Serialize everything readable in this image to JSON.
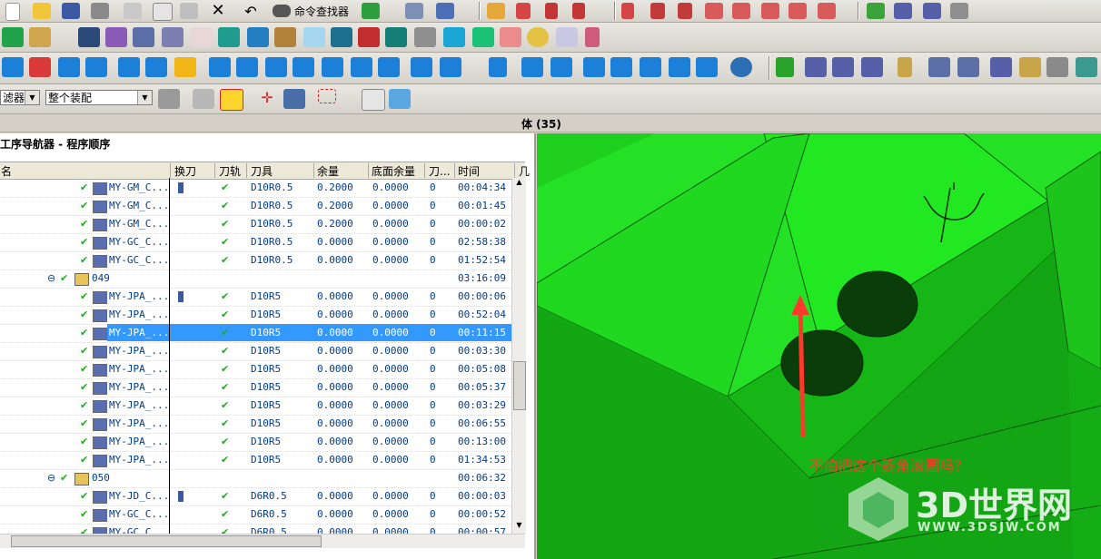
{
  "toolbar": {
    "command_finder_label": "命令查找器",
    "filter_label": "滤器",
    "assembly_selector": "整个装配"
  },
  "viewport": {
    "title": "体 (35)",
    "annotation": "不怕把这个菱角滚圆吗？",
    "watermark_brand": "3D世界网",
    "watermark_url": "WWW.3DSJW.COM",
    "colors": {
      "solid": "#22e022",
      "arrow": "#ff3a2a"
    }
  },
  "navigator": {
    "title": "工序导航器 - 程序顺序",
    "columns": [
      "名",
      "换刀",
      "刀轨",
      "刀具",
      "余量",
      "底面余量",
      "刀...",
      "时间",
      "几"
    ],
    "rows": [
      {
        "name": "MY-GM_C...",
        "tool_change": true,
        "path_ok": true,
        "tool": "D10R0.5",
        "stock": "0.2000",
        "floor": "0.0000",
        "tn": "0",
        "time": "00:04:34"
      },
      {
        "name": "MY-GM_C...",
        "tool_change": false,
        "path_ok": true,
        "tool": "D10R0.5",
        "stock": "0.2000",
        "floor": "0.0000",
        "tn": "0",
        "time": "00:01:45"
      },
      {
        "name": "MY-GM_C...",
        "tool_change": false,
        "path_ok": true,
        "tool": "D10R0.5",
        "stock": "0.2000",
        "floor": "0.0000",
        "tn": "0",
        "time": "00:00:02"
      },
      {
        "name": "MY-GC_C...",
        "tool_change": false,
        "path_ok": true,
        "tool": "D10R0.5",
        "stock": "0.0000",
        "floor": "0.0000",
        "tn": "0",
        "time": "02:58:38"
      },
      {
        "name": "MY-GC_C...",
        "tool_change": false,
        "path_ok": true,
        "tool": "D10R0.5",
        "stock": "0.0000",
        "floor": "0.0000",
        "tn": "0",
        "time": "01:52:54"
      },
      {
        "name": "049",
        "group": true,
        "tool_change": false,
        "path_ok": false,
        "tool": "",
        "stock": "",
        "floor": "",
        "tn": "",
        "time": "03:16:09"
      },
      {
        "name": "MY-JPA_...",
        "tool_change": true,
        "path_ok": true,
        "tool": "D10R5",
        "stock": "0.0000",
        "floor": "0.0000",
        "tn": "0",
        "time": "00:00:06"
      },
      {
        "name": "MY-JPA_...",
        "tool_change": false,
        "path_ok": true,
        "tool": "D10R5",
        "stock": "0.0000",
        "floor": "0.0000",
        "tn": "0",
        "time": "00:52:04"
      },
      {
        "name": "MY-JPA_...",
        "selected": true,
        "tool_change": false,
        "path_ok": true,
        "tool": "D10R5",
        "stock": "0.0000",
        "floor": "0.0000",
        "tn": "0",
        "time": "00:11:15"
      },
      {
        "name": "MY-JPA_...",
        "tool_change": false,
        "path_ok": true,
        "tool": "D10R5",
        "stock": "0.0000",
        "floor": "0.0000",
        "tn": "0",
        "time": "00:03:30"
      },
      {
        "name": "MY-JPA_...",
        "tool_change": false,
        "path_ok": true,
        "tool": "D10R5",
        "stock": "0.0000",
        "floor": "0.0000",
        "tn": "0",
        "time": "00:05:08"
      },
      {
        "name": "MY-JPA_...",
        "tool_change": false,
        "path_ok": true,
        "tool": "D10R5",
        "stock": "0.0000",
        "floor": "0.0000",
        "tn": "0",
        "time": "00:05:37"
      },
      {
        "name": "MY-JPA_...",
        "tool_change": false,
        "path_ok": true,
        "tool": "D10R5",
        "stock": "0.0000",
        "floor": "0.0000",
        "tn": "0",
        "time": "00:03:29"
      },
      {
        "name": "MY-JPA_...",
        "tool_change": false,
        "path_ok": true,
        "tool": "D10R5",
        "stock": "0.0000",
        "floor": "0.0000",
        "tn": "0",
        "time": "00:06:55"
      },
      {
        "name": "MY-JPA_...",
        "tool_change": false,
        "path_ok": true,
        "tool": "D10R5",
        "stock": "0.0000",
        "floor": "0.0000",
        "tn": "0",
        "time": "00:13:00"
      },
      {
        "name": "MY-JPA_...",
        "tool_change": false,
        "path_ok": true,
        "tool": "D10R5",
        "stock": "0.0000",
        "floor": "0.0000",
        "tn": "0",
        "time": "01:34:53"
      },
      {
        "name": "050",
        "group": true,
        "tool_change": false,
        "path_ok": false,
        "tool": "",
        "stock": "",
        "floor": "",
        "tn": "",
        "time": "00:06:32"
      },
      {
        "name": "MY-JD_C...",
        "tool_change": true,
        "path_ok": true,
        "tool": "D6R0.5",
        "stock": "0.0000",
        "floor": "0.0000",
        "tn": "0",
        "time": "00:00:03"
      },
      {
        "name": "MY-GC_C...",
        "tool_change": false,
        "path_ok": true,
        "tool": "D6R0.5",
        "stock": "0.0000",
        "floor": "0.0000",
        "tn": "0",
        "time": "00:00:52"
      },
      {
        "name": "MY-GC_C",
        "tool_change": false,
        "path_ok": true,
        "tool": "D6R0.5",
        "stock": "0.0000",
        "floor": "0.0000",
        "tn": "0",
        "time": "00:00:57"
      }
    ]
  }
}
